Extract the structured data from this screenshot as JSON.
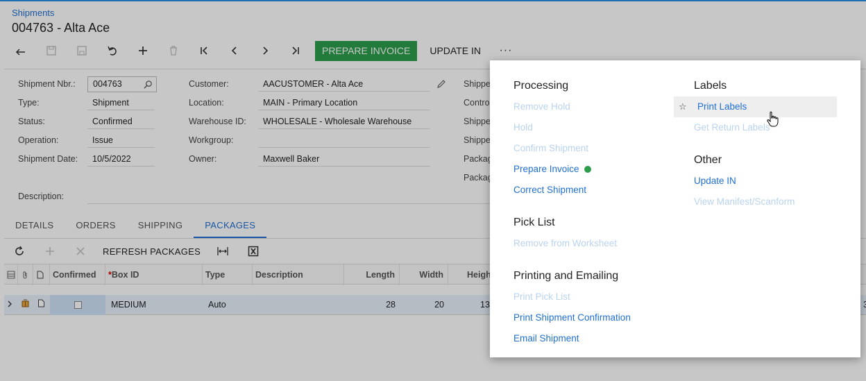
{
  "breadcrumb": "Shipments",
  "title": "004763 - Alta Ace",
  "toolbar": {
    "prepare_invoice": "PREPARE INVOICE",
    "update_in": "UPDATE IN",
    "more": "···"
  },
  "form": {
    "shipment_nbr_label": "Shipment Nbr.:",
    "shipment_nbr": "004763",
    "type_label": "Type:",
    "type": "Shipment",
    "status_label": "Status:",
    "status": "Confirmed",
    "operation_label": "Operation:",
    "operation": "Issue",
    "shipment_date_label": "Shipment Date:",
    "shipment_date": "10/5/2022",
    "customer_label": "Customer:",
    "customer": "AACUSTOMER - Alta Ace",
    "location_label": "Location:",
    "location": "MAIN - Primary Location",
    "warehouse_label": "Warehouse ID:",
    "warehouse": "WHOLESALE - Wholesale Warehouse",
    "workgroup_label": "Workgroup:",
    "workgroup": "",
    "owner_label": "Owner:",
    "owner": "Maxwell Baker",
    "description_label": "Description:",
    "right_labels": [
      "Shippe",
      "Contro",
      "Shippe",
      "Shippe",
      "Packag",
      "Packag"
    ]
  },
  "tabs": [
    "DETAILS",
    "ORDERS",
    "SHIPPING",
    "PACKAGES"
  ],
  "grid_toolbar": {
    "refresh_packages": "REFRESH PACKAGES"
  },
  "grid": {
    "columns": {
      "confirmed": "Confirmed",
      "box_id": "Box ID",
      "type": "Type",
      "description": "Description",
      "length": "Length",
      "width": "Width",
      "height": "Heigh"
    },
    "row": {
      "box_id": "MEDIUM",
      "type": "Auto",
      "length": "28",
      "width": "20",
      "height": "13",
      "trailing": "3"
    }
  },
  "menu": {
    "processing": {
      "title": "Processing",
      "items": [
        "Remove Hold",
        "Hold",
        "Confirm Shipment",
        "Prepare Invoice",
        "Correct Shipment"
      ]
    },
    "pick_list": {
      "title": "Pick List",
      "items": [
        "Remove from Worksheet"
      ]
    },
    "printing": {
      "title": "Printing and Emailing",
      "items": [
        "Print Pick List",
        "Print Shipment Confirmation",
        "Email Shipment"
      ]
    },
    "labels": {
      "title": "Labels",
      "items": [
        "Print Labels",
        "Get Return Labels"
      ]
    },
    "other": {
      "title": "Other",
      "items": [
        "Update IN",
        "View Manifest/Scanform"
      ]
    }
  },
  "colors": {
    "accent": "#1f6fd1",
    "success": "#2c9e4b"
  }
}
